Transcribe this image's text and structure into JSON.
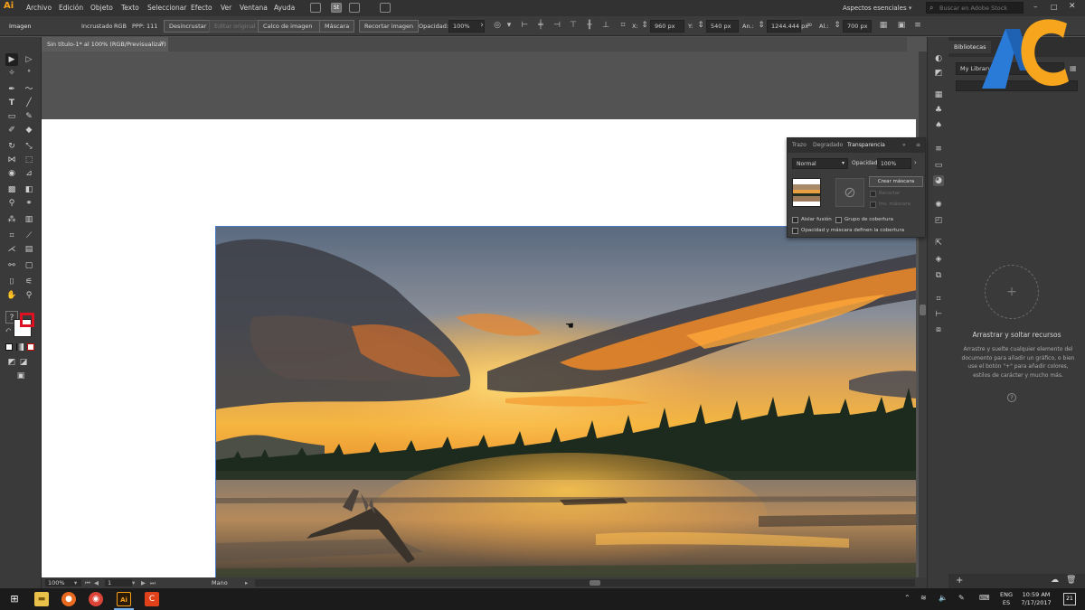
{
  "menubar": {
    "logo": "Ai",
    "items": [
      "Archivo",
      "Edición",
      "Objeto",
      "Texto",
      "Seleccionar",
      "Efecto",
      "Ver",
      "Ventana",
      "Ayuda"
    ],
    "st_label": "St",
    "workspace": "Aspectos esenciales",
    "search_placeholder": "Buscar en Adobe Stock"
  },
  "controlbar": {
    "selection_type": "Imagen",
    "embedded": "Incrustado",
    "color_mode": "RGB",
    "ppi": "PPP: 111",
    "unembed_button": "Desincrustar",
    "edit_original_button": "Editar original",
    "image_trace_button": "Calco de imagen",
    "mask_button": "Máscara",
    "crop_button": "Recortar imagen",
    "opacity_label": "Opacidad:",
    "opacity_value": "100%",
    "x_label": "X:",
    "x_value": "960 px",
    "y_label": "Y:",
    "y_value": "540 px",
    "width_label": "An.:",
    "width_value": "1244.444 px",
    "height_label": "Al.:",
    "height_value": "700 px"
  },
  "document": {
    "tab_title": "Sin título-1* al 100% (RGB/Previsualizar)"
  },
  "statusbar": {
    "zoom": "100%",
    "artboard_number": "1",
    "tool_name": "Mano"
  },
  "transparency_panel": {
    "tabs": [
      "Trazo",
      "Degradado",
      "Transparencia"
    ],
    "blend_mode": "Normal",
    "opacity_label": "Opacidad:",
    "opacity_value": "100%",
    "make_mask_button": "Crear máscara",
    "clip_label": "Recortar",
    "invert_mask_label": "Inv. máscara",
    "isolate_blending_label": "Aislar fusión",
    "knockout_group_label": "Grupo de cobertura",
    "opacity_mask_label": "Opacidad y máscara definen la cobertura"
  },
  "libraries_panel": {
    "tab": "Bibliotecas",
    "library": "My Library",
    "drop_title": "Arrastrar y soltar recursos",
    "drop_description": "Arrastre y suelte cualquier elemento del documento para añadir un gráfico, o bien use el botón \"+\" para añadir colores, estilos de carácter y mucho más."
  },
  "taskbar": {
    "lang_top": "ENG",
    "lang_bottom": "ES",
    "time": "10:59 AM",
    "date": "7/17/2017",
    "notification_count": "21"
  },
  "colors": {
    "app_bg": "#535353",
    "panel": "#3a3a3a",
    "ai_orange": "#f6a01a",
    "selection_blue": "#4a79c9",
    "watermark_orange": "#f7a51c",
    "watermark_blue": "#2a7bd8"
  }
}
